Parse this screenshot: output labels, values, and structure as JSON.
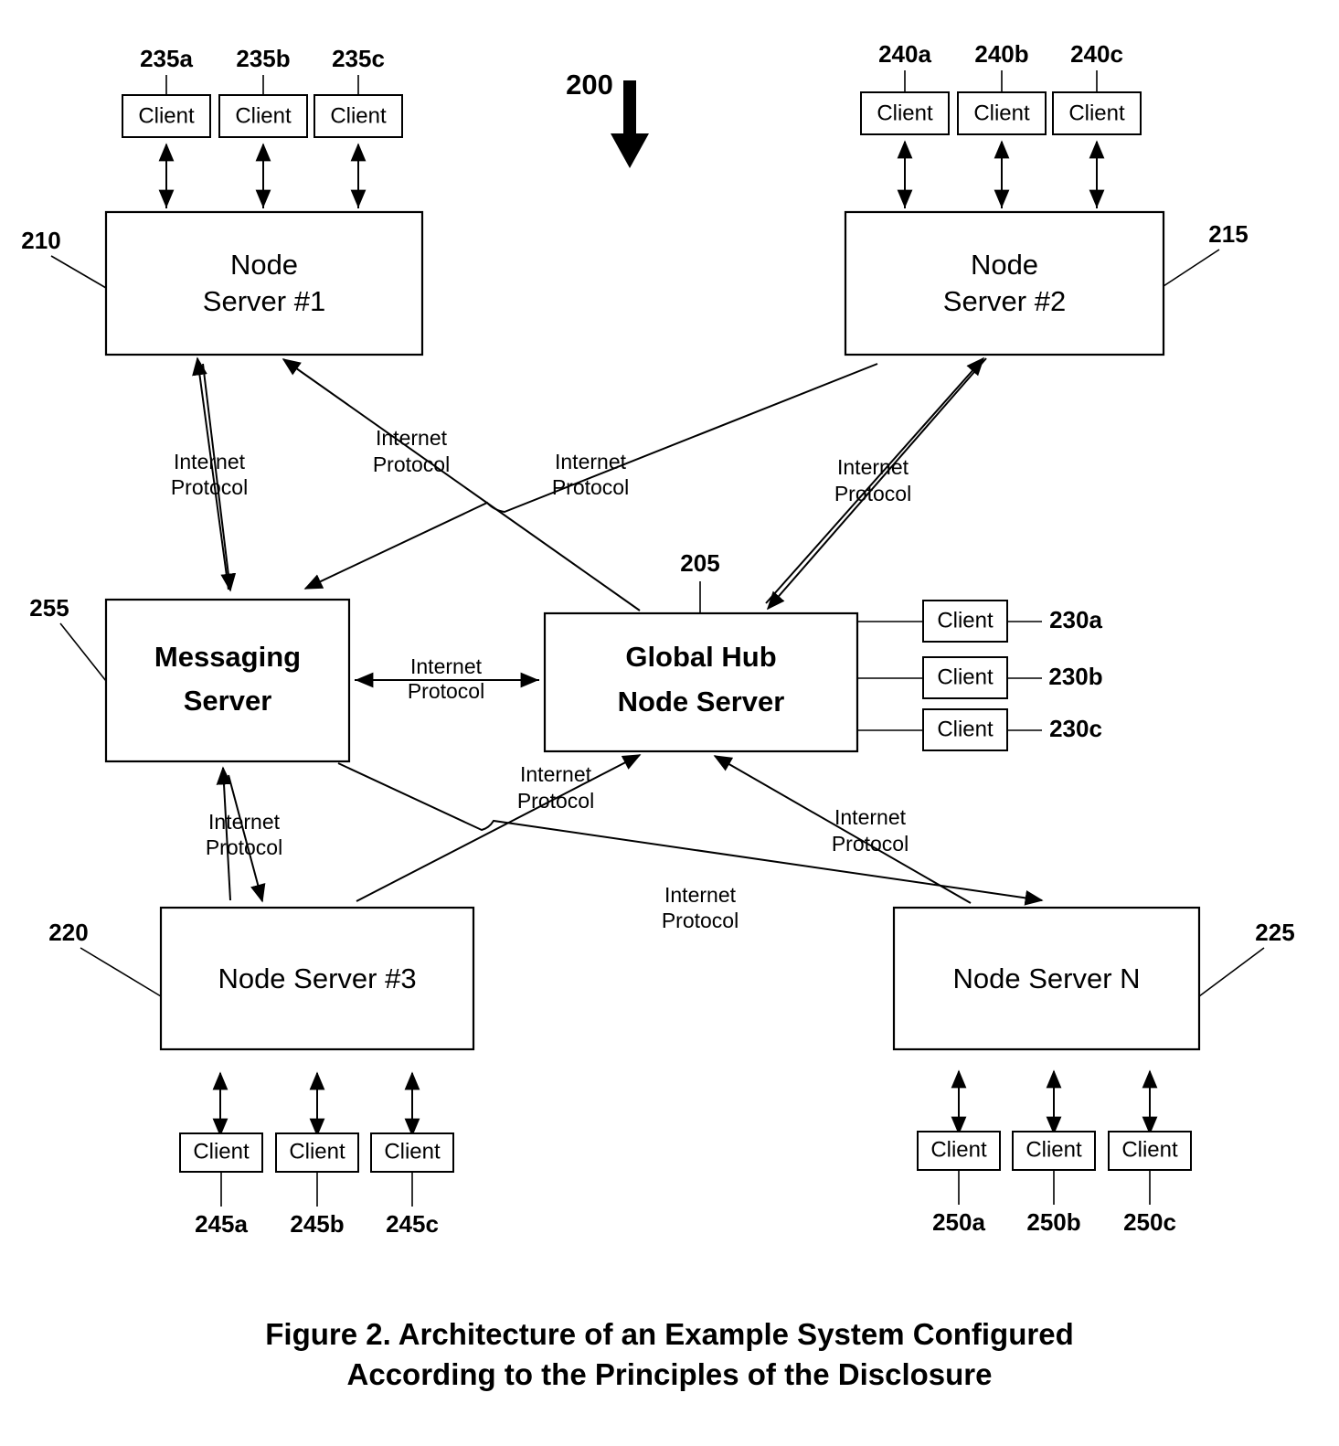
{
  "figure": {
    "ref_number": "200",
    "caption_line1": "Figure 2. Architecture of an Example System Configured",
    "caption_line2": "According to the Principles of the Disclosure"
  },
  "nodes": {
    "node_server_1": {
      "ref": "210",
      "line1": "Node",
      "line2": "Server #1"
    },
    "node_server_2": {
      "ref": "215",
      "line1": "Node",
      "line2": "Server #2"
    },
    "node_server_3": {
      "ref": "220",
      "line1": "Node Server #3"
    },
    "node_server_n": {
      "ref": "225",
      "line1": "Node Server N"
    },
    "global_hub": {
      "ref": "205",
      "line1": "Global Hub",
      "line2": "Node Server"
    },
    "messaging": {
      "ref": "255",
      "line1": "Messaging",
      "line2": "Server"
    }
  },
  "client_label": "Client",
  "client_groups": {
    "ns1_clients": {
      "refs": [
        "235a",
        "235b",
        "235c"
      ]
    },
    "ns2_clients": {
      "refs": [
        "240a",
        "240b",
        "240c"
      ]
    },
    "ns3_clients": {
      "refs": [
        "245a",
        "245b",
        "245c"
      ]
    },
    "nsn_clients": {
      "refs": [
        "250a",
        "250b",
        "250c"
      ]
    },
    "hub_clients": {
      "refs": [
        "230a",
        "230b",
        "230c"
      ]
    }
  },
  "link_label": {
    "line1": "Internet",
    "line2": "Protocol"
  },
  "links": [
    {
      "id": "ns1-messaging",
      "from": "node_server_1",
      "to": "messaging",
      "label": "Internet Protocol"
    },
    {
      "id": "hub-ns1",
      "from": "global_hub",
      "to": "node_server_1",
      "label": "Internet Protocol"
    },
    {
      "id": "messaging-hub-upper",
      "from": "messaging",
      "to": "global_hub",
      "label": "Internet Protocol"
    },
    {
      "id": "ns2-hub",
      "from": "node_server_2",
      "to": "global_hub",
      "label": "Internet Protocol"
    },
    {
      "id": "messaging-hub",
      "from": "messaging",
      "to": "global_hub",
      "label": "Internet Protocol",
      "bidirectional": true
    },
    {
      "id": "messaging-ns3",
      "from": "messaging",
      "to": "node_server_3",
      "label": "Internet Protocol"
    },
    {
      "id": "ns3-hub",
      "from": "node_server_3",
      "to": "global_hub",
      "label": "Internet Protocol"
    },
    {
      "id": "hub-nsn",
      "from": "global_hub",
      "to": "node_server_n",
      "label": "Internet Protocol"
    },
    {
      "id": "nsn-hub",
      "from": "node_server_n",
      "to": "global_hub",
      "label": "Internet Protocol"
    }
  ],
  "colors": {
    "stroke": "#000000",
    "fill": "#ffffff"
  }
}
